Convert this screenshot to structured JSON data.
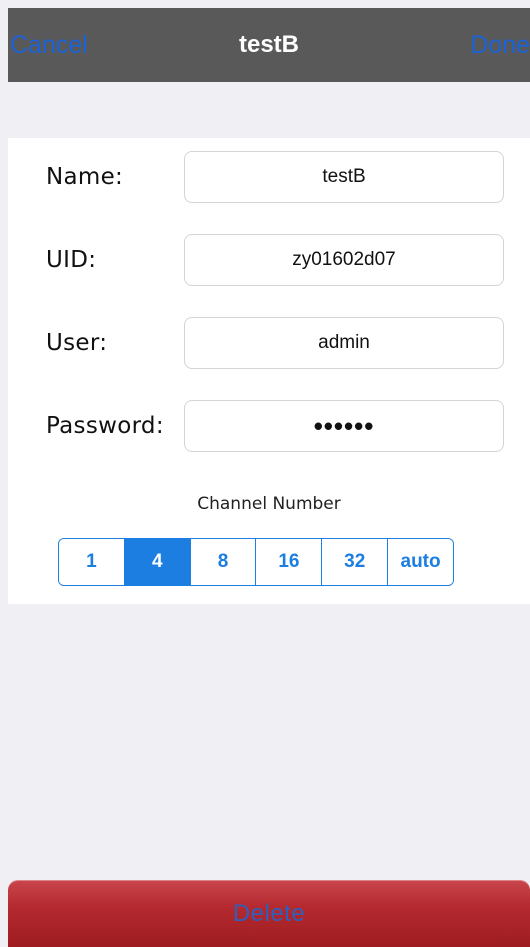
{
  "navbar": {
    "cancel_label": "Cancel",
    "title": "testB",
    "done_label": "Done"
  },
  "form": {
    "name": {
      "label": "Name:",
      "value": "testB"
    },
    "uid": {
      "label": "UID:",
      "value": "zy01602d07"
    },
    "user": {
      "label": "User:",
      "value": "admin"
    },
    "password": {
      "label": "Password:",
      "value": "••••••"
    }
  },
  "channel": {
    "label": "Channel Number",
    "options": [
      "1",
      "4",
      "8",
      "16",
      "32",
      "auto"
    ],
    "selected": "4"
  },
  "delete_label": "Delete",
  "colors": {
    "navbar_bg": "#595959",
    "nav_link": "#1c63d8",
    "accent": "#1c7ee0",
    "delete_red": "#b42a30",
    "background": "#efeff4"
  }
}
